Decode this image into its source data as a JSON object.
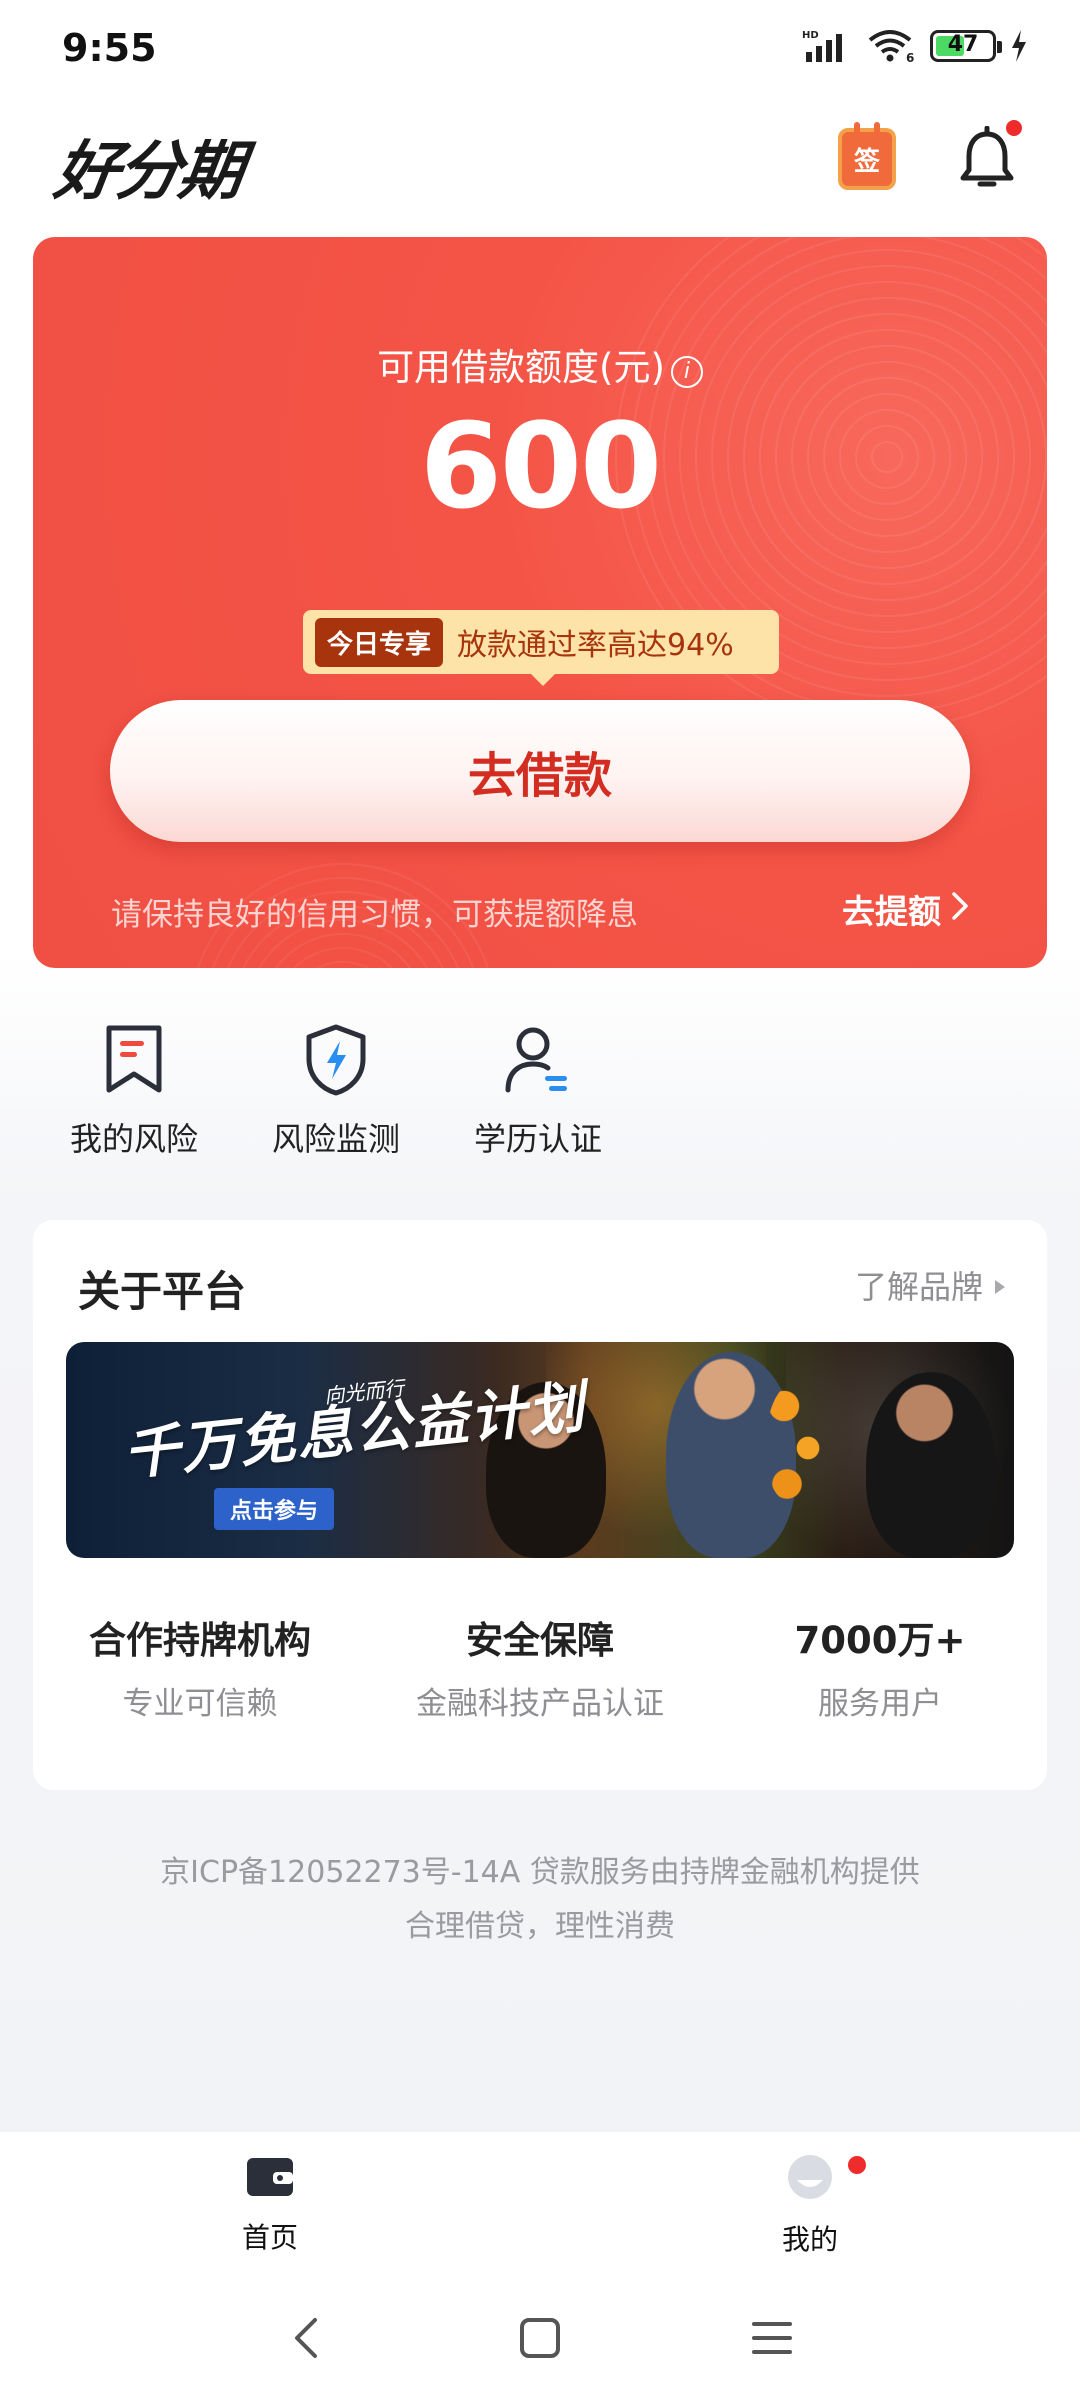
{
  "status_bar": {
    "time": "9:55",
    "network": "HD",
    "wifi_badge": "6",
    "battery": "47"
  },
  "header": {
    "logo": "好分期",
    "sign_icon_text": "签",
    "notification_dot_color": "#ee2c2c"
  },
  "hero": {
    "label": "可用借款额度(元)",
    "info_icon": "i",
    "amount": "600",
    "promo_tag": "今日专享",
    "promo_text": "放款通过率高达94%",
    "button": "去借款",
    "tip": "请保持良好的信用习惯，可获提额降息",
    "raise_link": "去提额",
    "accent_color": "#f04f43"
  },
  "quick_actions": [
    {
      "label": "我的风险",
      "icon": "bookmark-risk-icon"
    },
    {
      "label": "风险监测",
      "icon": "shield-lightning-icon"
    },
    {
      "label": "学历认证",
      "icon": "user-certify-icon"
    }
  ],
  "about": {
    "title": "关于平台",
    "more": "了解品牌",
    "banner": {
      "title": "千万免息公益计划",
      "subtitle": "向光而行",
      "cta": "点击参与"
    },
    "stats": [
      {
        "value": "合作持牌机构",
        "label": "专业可信赖"
      },
      {
        "value": "安全保障",
        "label": "金融科技产品认证"
      },
      {
        "value": "7000万+",
        "label": "服务用户"
      }
    ]
  },
  "footer": {
    "line1": "京ICP备12052273号-14A 贷款服务由持牌金融机构提供",
    "line2": "合理借贷，理性消费"
  },
  "tabbar": {
    "tabs": [
      {
        "label": "首页",
        "icon": "wallet-icon"
      },
      {
        "label": "我的",
        "icon": "profile-icon"
      }
    ]
  },
  "system_nav": [
    "back",
    "home",
    "menu"
  ]
}
